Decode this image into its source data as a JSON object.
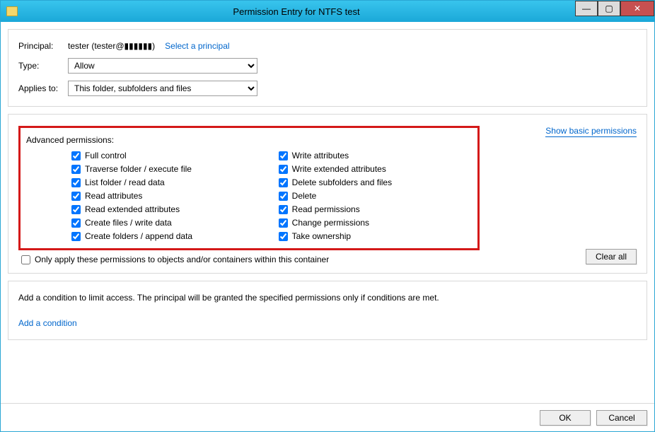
{
  "window": {
    "title": "Permission Entry for NTFS test"
  },
  "top": {
    "principal_label": "Principal:",
    "principal_value": "tester (tester@▮▮▮▮▮▮)",
    "select_principal": "Select a principal",
    "type_label": "Type:",
    "type_value": "Allow",
    "applies_label": "Applies to:",
    "applies_value": "This folder, subfolders and files"
  },
  "perms": {
    "header": "Advanced permissions:",
    "show_basic": "Show basic permissions",
    "left": [
      "Full control",
      "Traverse folder / execute file",
      "List folder / read data",
      "Read attributes",
      "Read extended attributes",
      "Create files / write data",
      "Create folders / append data"
    ],
    "right": [
      "Write attributes",
      "Write extended attributes",
      "Delete subfolders and files",
      "Delete",
      "Read permissions",
      "Change permissions",
      "Take ownership"
    ],
    "only_apply": "Only apply these permissions to objects and/or containers within this container",
    "clear_all": "Clear all"
  },
  "cond": {
    "text": "Add a condition to limit access. The principal will be granted the specified permissions only if conditions are met.",
    "add": "Add a condition"
  },
  "footer": {
    "ok": "OK",
    "cancel": "Cancel"
  }
}
